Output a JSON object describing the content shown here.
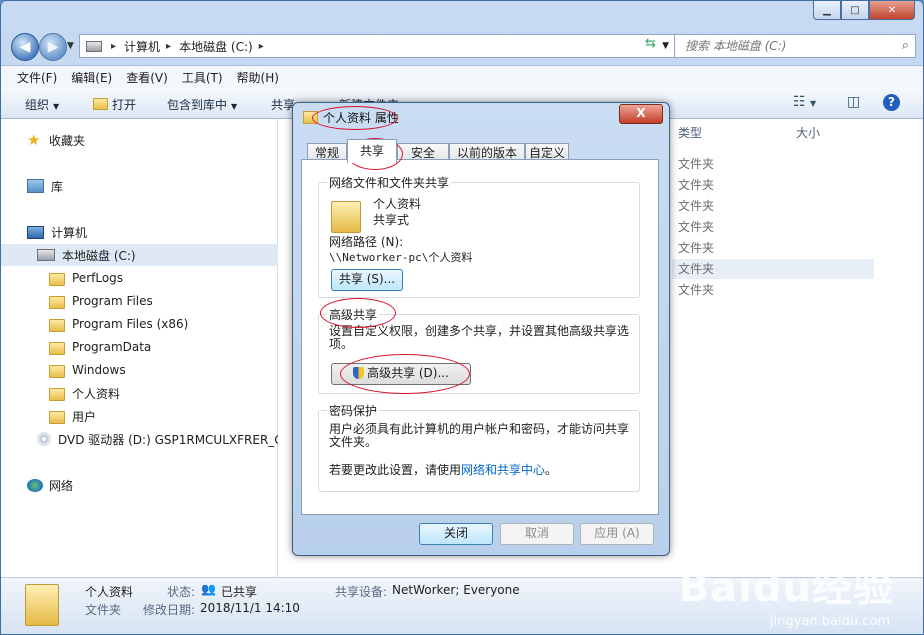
{
  "breadcrumb": [
    "计算机",
    "本地磁盘 (C:)"
  ],
  "search_placeholder": "搜索 本地磁盘 (C:)",
  "menubar": [
    "文件(F)",
    "编辑(E)",
    "查看(V)",
    "工具(T)",
    "帮助(H)"
  ],
  "toolbar": {
    "organize": "组织",
    "open": "打开",
    "include": "包含到库中",
    "share": "共享",
    "newfolder": "新建文件夹"
  },
  "nav": {
    "favorites": "收藏夹",
    "libraries": "库",
    "computer": "计算机",
    "drive_c": "本地磁盘 (C:)",
    "folders": [
      "PerfLogs",
      "Program Files",
      "Program Files (x86)",
      "ProgramData",
      "Windows",
      "个人资料",
      "用户"
    ],
    "dvd": "DVD 驱动器 (D:) GSP1RMCULXFRER_C",
    "network": "网络"
  },
  "columns": {
    "type": "类型",
    "size": "大小"
  },
  "rows": [
    "文件夹",
    "文件夹",
    "文件夹",
    "文件夹",
    "文件夹",
    "文件夹",
    "文件夹"
  ],
  "details": {
    "name": "个人资料",
    "type": "文件夹",
    "state_label": "状态:",
    "state_value": "已共享",
    "modified_label": "修改日期:",
    "modified_value": "2018/11/1 14:10",
    "share_label": "共享设备:",
    "share_value": "NetWorker; Everyone"
  },
  "dialog": {
    "title": "个人资料 属性",
    "close": "X",
    "tabs": [
      "常规",
      "共享",
      "安全",
      "以前的版本",
      "自定义"
    ],
    "net_group": "网络文件和文件夹共享",
    "folder_name": "个人资料",
    "folder_state": "共享式",
    "path_label": "网络路径 (N):",
    "path_value": "\\\\Networker-pc\\个人资料",
    "share_button": "共享 (S)...",
    "adv_group": "高级共享",
    "adv_desc": "设置自定义权限，创建多个共享，并设置其他高级共享选项。",
    "adv_button": "高级共享 (D)...",
    "pwd_group": "密码保护",
    "pwd_desc": "用户必须具有此计算机的用户帐户和密码，才能访问共享文件夹。",
    "pwd_change_prefix": "若要更改此设置，请使用",
    "pwd_link": "网络和共享中心",
    "pwd_change_suffix": "。",
    "btn_close": "关闭",
    "btn_cancel": "取消",
    "btn_apply": "应用 (A)"
  },
  "watermark": {
    "brand": "Baidu经验",
    "url": "jingyan.baidu.com"
  }
}
